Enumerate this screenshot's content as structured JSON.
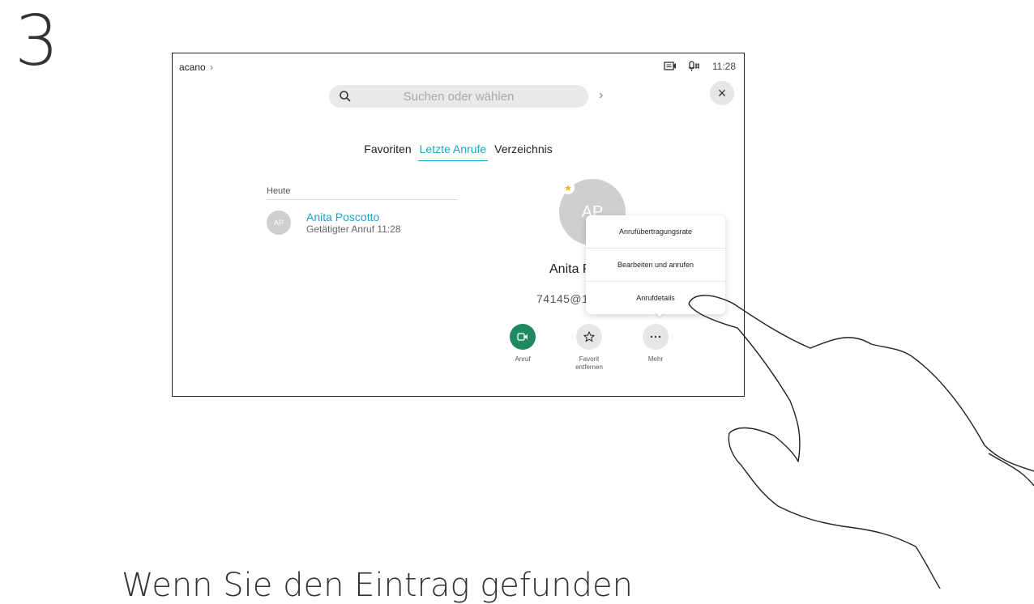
{
  "step": {
    "number": "3"
  },
  "instruction": {
    "text": "Wenn Sie den Eintrag gefunden"
  },
  "device": {
    "breadcrumb": {
      "label": "acano",
      "chevron": "›"
    },
    "status": {
      "time": "11:28",
      "icons": [
        "screen-share-icon",
        "microphone-icon"
      ]
    },
    "search": {
      "placeholder": "Suchen oder wählen",
      "chevron": "›"
    },
    "close": {
      "glyph": "×"
    },
    "tabs": [
      {
        "label": "Favoriten",
        "active": false
      },
      {
        "label": "Letzte Anrufe",
        "active": true
      },
      {
        "label": "Verzeichnis",
        "active": false
      }
    ],
    "recent": {
      "section": "Heute",
      "items": [
        {
          "initials": "AP",
          "name": "Anita Poscotto",
          "detail": "Getätigter Anruf 11:28"
        }
      ]
    },
    "detail": {
      "initials": "AP",
      "name": "Anita P",
      "uri": "74145@1",
      "favorite_icon": "star-icon"
    },
    "menu": {
      "items": [
        "Anrufübertragungsrate",
        "Bearbeiten und anrufen",
        "Anrufdetails"
      ]
    },
    "actions": [
      {
        "id": "call",
        "label": "Anruf",
        "icon": "video-call-icon",
        "color": "#1e8a5f"
      },
      {
        "id": "unfavorite",
        "label": "Favorit entfernen",
        "icon": "star-outline-icon",
        "color": "#e6e6e6"
      },
      {
        "id": "more",
        "label": "Mehr",
        "icon": "more-icon",
        "color": "#e6e6e6"
      }
    ]
  },
  "colors": {
    "accent": "#1aa6c9",
    "call_green": "#1e8a5f",
    "favorite_star": "#f2b319"
  }
}
